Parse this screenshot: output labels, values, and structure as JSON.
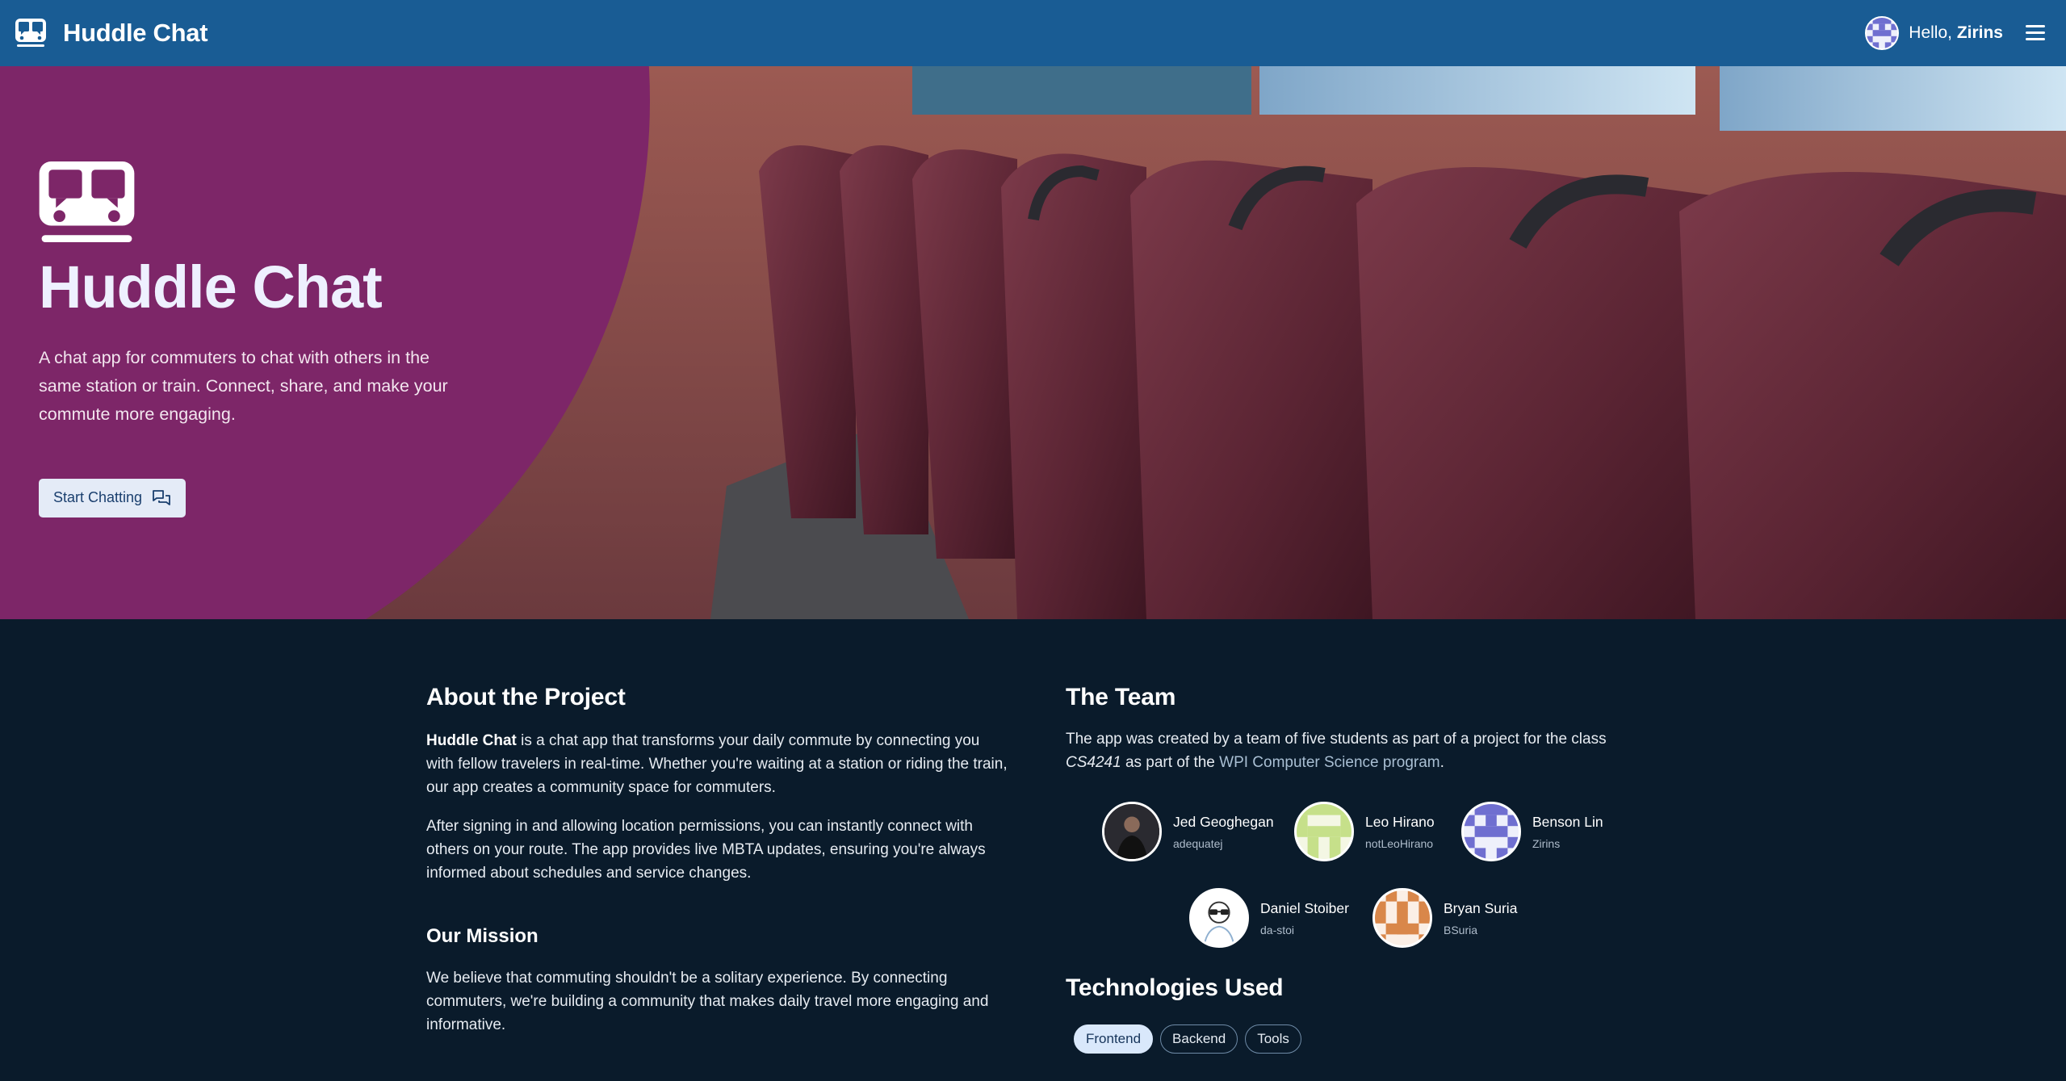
{
  "app": {
    "title": "Huddle Chat",
    "logo_icon": "bus-chat-icon"
  },
  "header": {
    "greeting_prefix": "Hello, ",
    "username": "Zirins",
    "menu_icon": "hamburger-menu-icon"
  },
  "hero": {
    "title": "Huddle Chat",
    "description": "A chat app for commuters to chat with others in the same station or train. Connect, share, and make your commute more engaging.",
    "cta_label": "Start Chatting",
    "cta_icon": "chat-bubbles-icon"
  },
  "about": {
    "heading": "About the Project",
    "p1_bold": "Huddle Chat",
    "p1_rest": " is a chat app that transforms your daily commute by connecting you with fellow travelers in real-time. Whether you're waiting at a station or riding the train, our app creates a community space for commuters.",
    "p2": "After signing in and allowing location permissions, you can instantly connect with others on your route. The app provides live MBTA updates, ensuring you're always informed about schedules and service changes."
  },
  "mission": {
    "heading": "Our Mission",
    "text": "We believe that commuting shouldn't be a solitary experience. By connecting commuters, we're building a community that makes daily travel more engaging and informative."
  },
  "team": {
    "heading": "The Team",
    "intro_a": "The app was created by a team of five students as part of a project for the class ",
    "intro_class": "CS4241",
    "intro_b": " as part of the ",
    "intro_link": "WPI Computer Science program",
    "intro_end": ".",
    "members": [
      {
        "name": "Jed Geoghegan",
        "username": "adequatej"
      },
      {
        "name": "Leo Hirano",
        "username": "notLeoHirano"
      },
      {
        "name": "Benson Lin",
        "username": "Zirins"
      },
      {
        "name": "Daniel Stoiber",
        "username": "da-stoi"
      },
      {
        "name": "Bryan Suria",
        "username": "BSuria"
      }
    ]
  },
  "tech": {
    "heading": "Technologies Used",
    "tabs": [
      "Frontend",
      "Backend",
      "Tools"
    ],
    "active_tab": "Frontend"
  },
  "colors": {
    "header_bg": "#195c94",
    "hero_accent": "#7d2668",
    "page_bg": "#0a1b2b"
  }
}
